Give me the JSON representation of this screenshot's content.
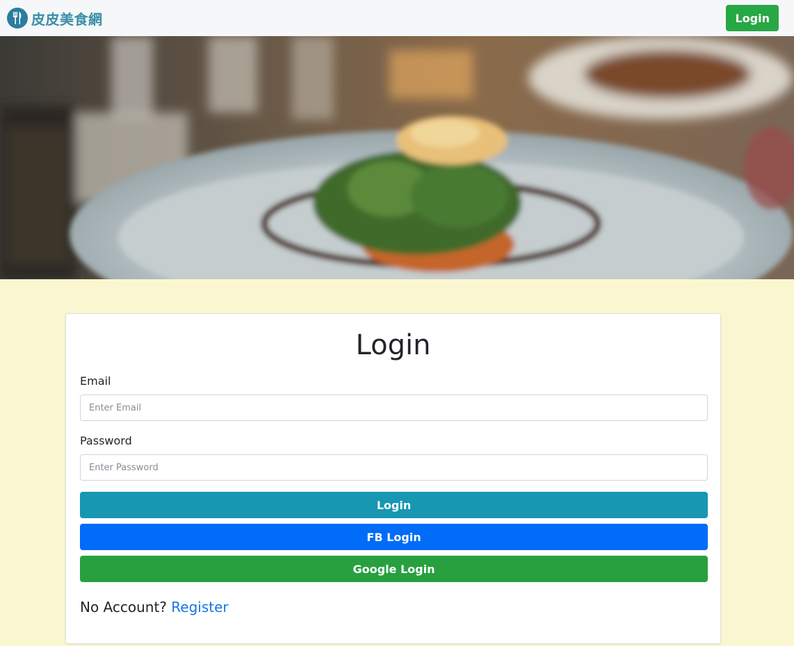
{
  "navbar": {
    "brand_name": "皮皮美食網",
    "brand_icon": "fork-knife-icon",
    "login_label": "Login",
    "login_color": "#28a745"
  },
  "hero": {
    "image": "plated-food-photo"
  },
  "login_form": {
    "title": "Login",
    "email_label": "Email",
    "email_placeholder": "Enter Email",
    "email_value": "",
    "password_label": "Password",
    "password_placeholder": "Enter Password",
    "password_value": "",
    "login_button": "Login",
    "fb_button": "FB Login",
    "google_button": "Google Login",
    "no_account_text": "No Account?",
    "register_link": "Register"
  },
  "colors": {
    "page_background": "#faf7d0",
    "login_button": "#1797b2",
    "fb_button": "#006cf7",
    "google_button": "#28a03f",
    "link": "#1a73e8"
  }
}
